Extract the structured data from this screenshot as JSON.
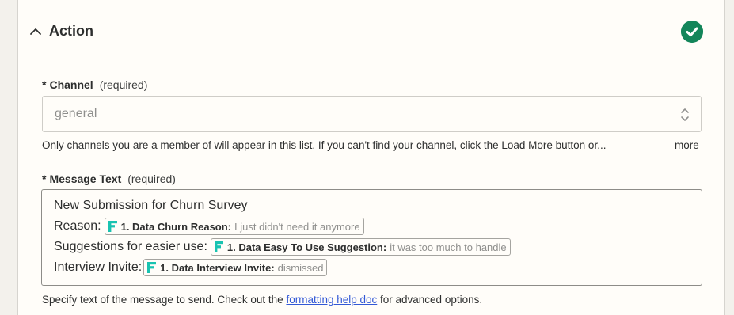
{
  "section": {
    "title": "Action",
    "status_icon": "check-circle-icon",
    "status_color": "#13855a"
  },
  "channel_field": {
    "star": "*",
    "label": "Channel",
    "required": "(required)",
    "value": "general",
    "hint": "Only channels you are a member of will appear in this list. If you can't find your channel, click the Load More button or...",
    "more_label": "more"
  },
  "message_field": {
    "star": "*",
    "label": "Message Text",
    "required": "(required)",
    "lines": [
      {
        "text": "New Submission for Churn Survey"
      },
      {
        "text": "Reason:",
        "pill": {
          "icon": "forms-app-icon",
          "label": "1. Data Churn Reason:",
          "value": "I just didn't need it anymore"
        }
      },
      {
        "text": "Suggestions for easier use:",
        "pill": {
          "icon": "forms-app-icon",
          "label": "1. Data Easy To Use Suggestion:",
          "value": "it was too much to handle"
        }
      },
      {
        "text": "Interview Invite:",
        "pill": {
          "icon": "forms-app-icon",
          "label": "1. Data Interview Invite:",
          "value": "dismissed"
        }
      }
    ],
    "hint_prefix": "Specify text of the message to send. Check out the ",
    "hint_link": "formatting help doc",
    "hint_suffix": " for advanced options."
  },
  "colors": {
    "accent_icon": "#19c3b1",
    "link": "#3258d6"
  }
}
